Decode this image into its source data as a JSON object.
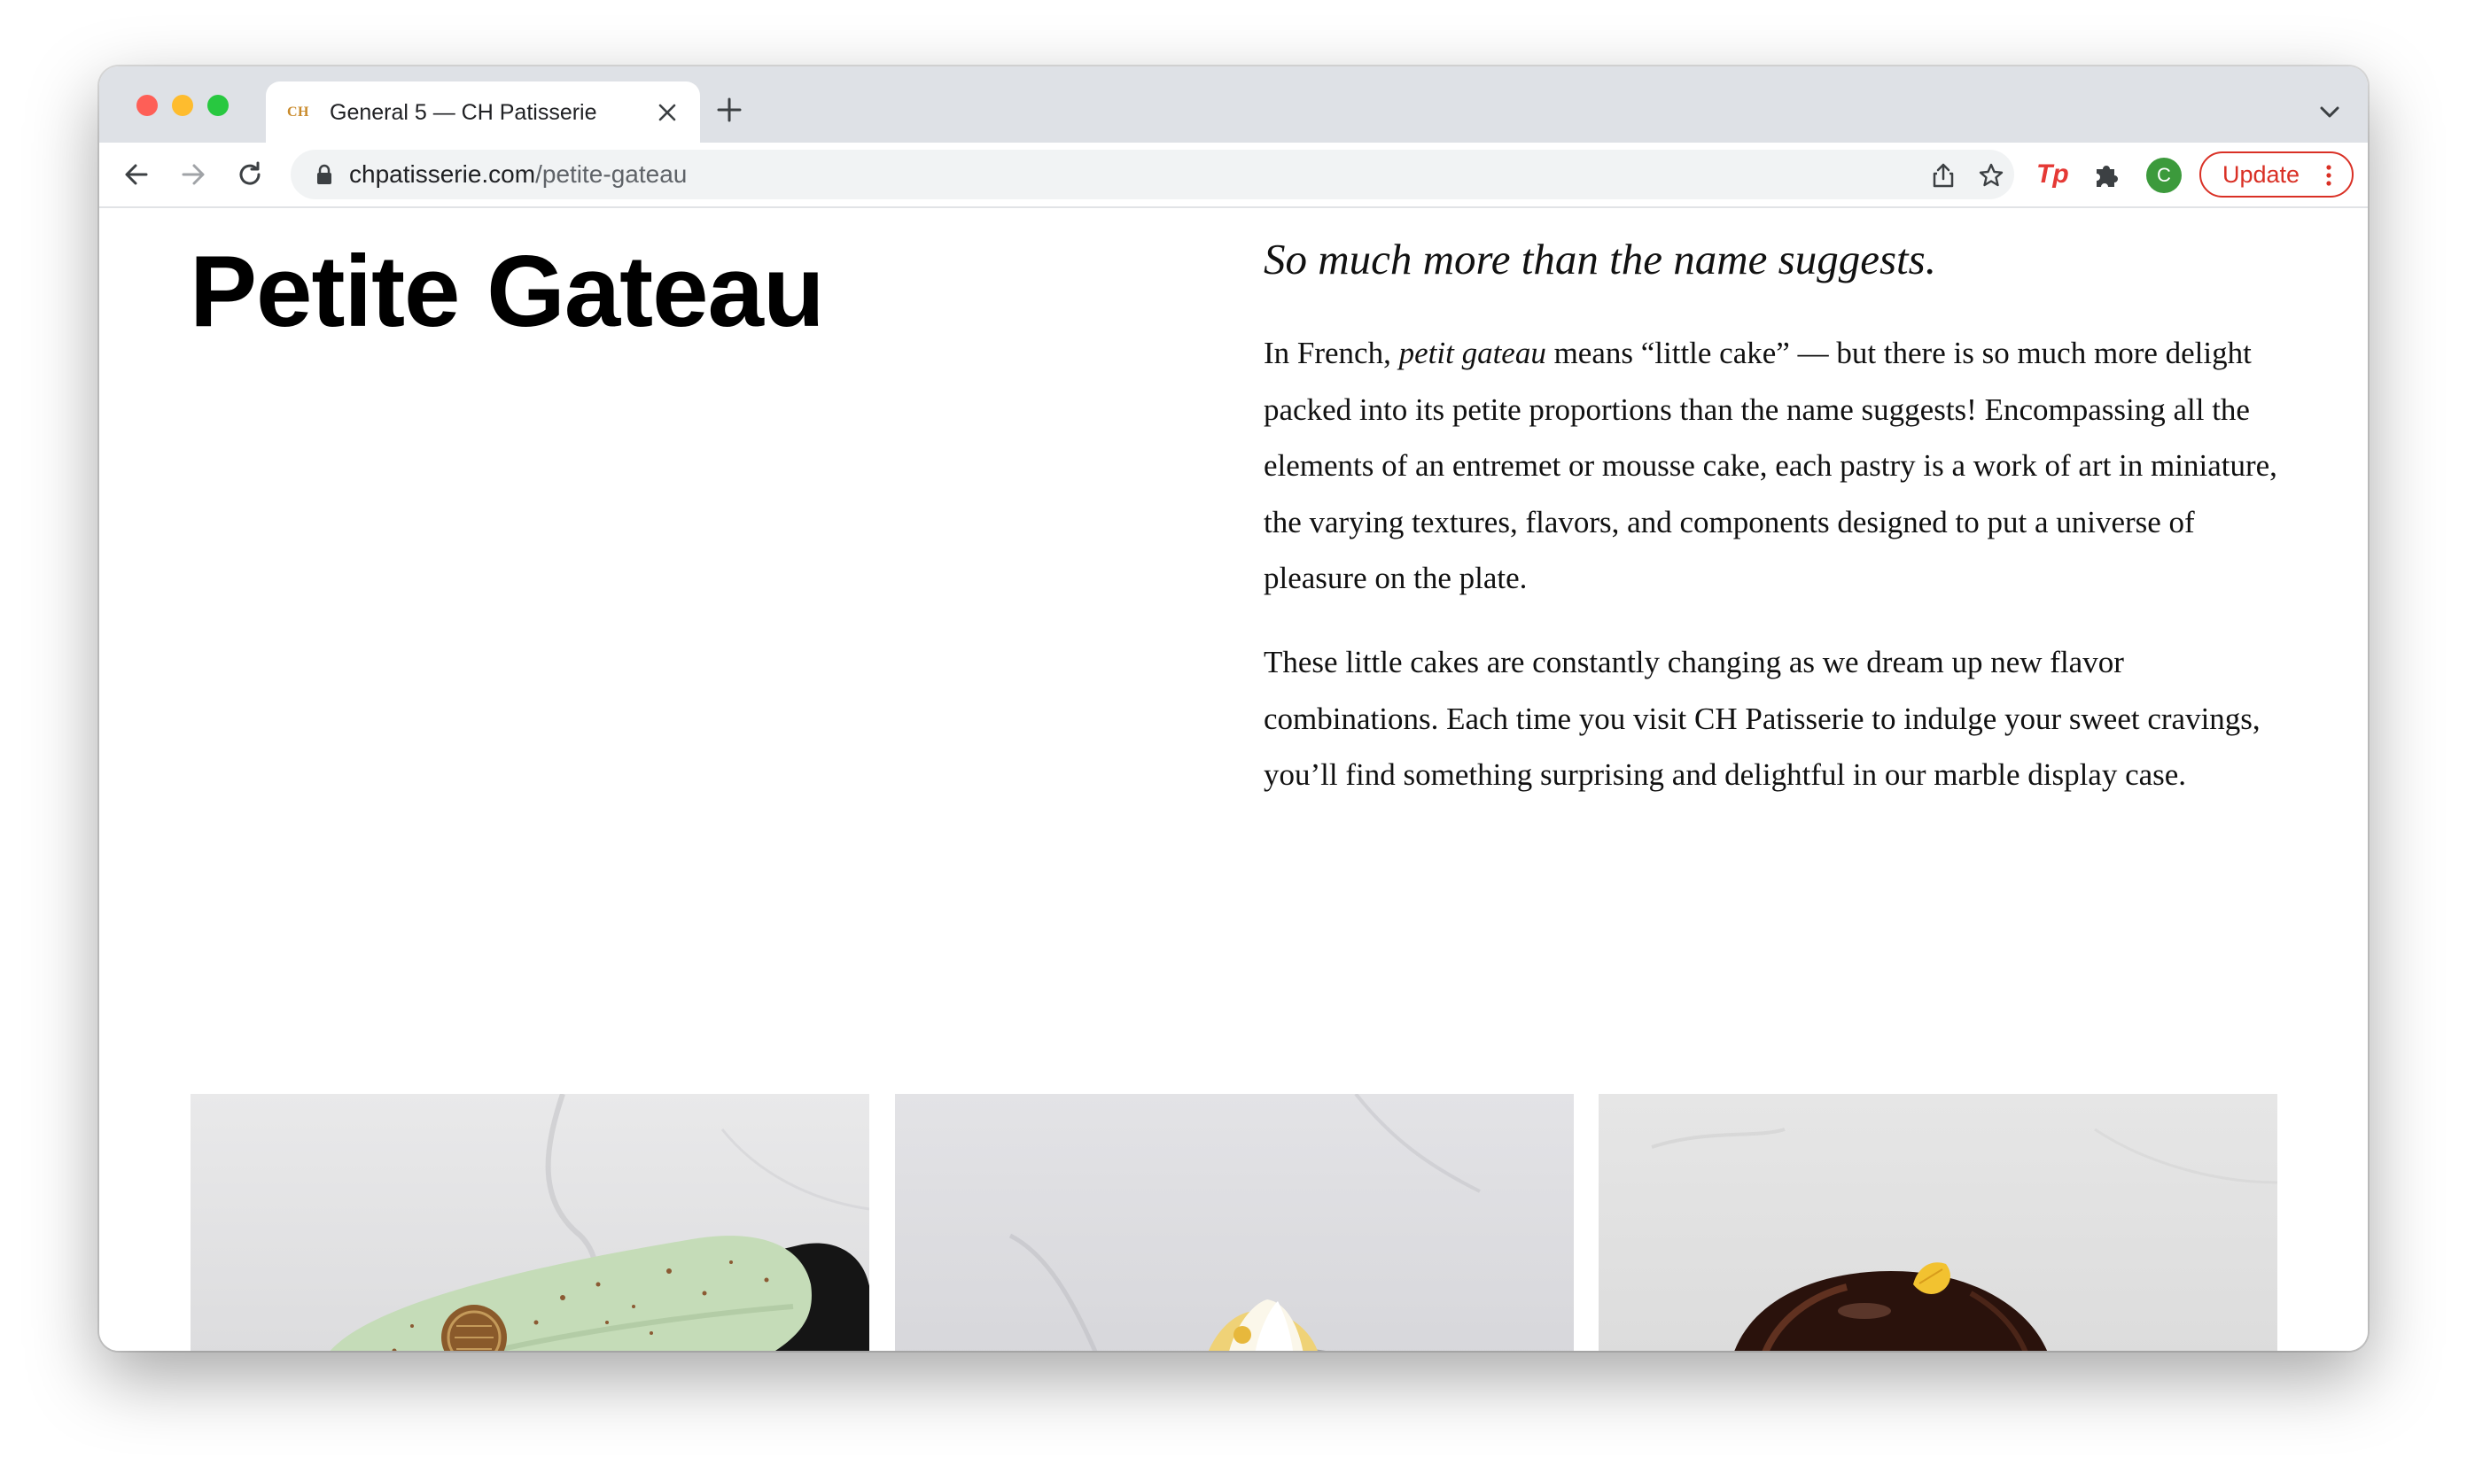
{
  "browser": {
    "tab": {
      "favicon_text": "CH",
      "title": "General 5 — CH Patisserie"
    },
    "url": {
      "domain": "chpatisserie.com",
      "path": "/petite-gateau"
    },
    "extension_label": "Tp",
    "avatar_initial": "C",
    "update_label": "Update"
  },
  "page": {
    "title": "Petite Gateau",
    "tagline": "So much more than the name suggests.",
    "intro": {
      "before_italic": "In French, ",
      "italic": "petit gateau",
      "after_italic": " means “little cake” — but there is so much more delight packed into its petite proportions than the name suggests! Encompassing all the elements of an entremet or mousse cake, each pastry is a work of art in miniature, the varying textures, flavors, and components designed to put a universe of pleasure on the plate."
    },
    "second_paragraph": "These little cakes are constantly changing as we dream up new flavor combinations. Each time you visit CH Patisserie to indulge your sweet cravings, you’ll find something surprising and delightful in our marble display case."
  },
  "colors": {
    "tab_bar": "#dee1e6",
    "update_accent": "#d93025",
    "avatar": "#3c9a3c",
    "pistachio_glaze": "#c5dcb8",
    "chocolate_glaze": "#2a120c"
  },
  "icons": [
    "close-icon",
    "plus-icon",
    "chevron-down-icon",
    "back-arrow-icon",
    "forward-arrow-icon",
    "reload-icon",
    "lock-icon",
    "share-icon",
    "star-icon",
    "puzzle-icon",
    "kebab-menu-icon"
  ]
}
